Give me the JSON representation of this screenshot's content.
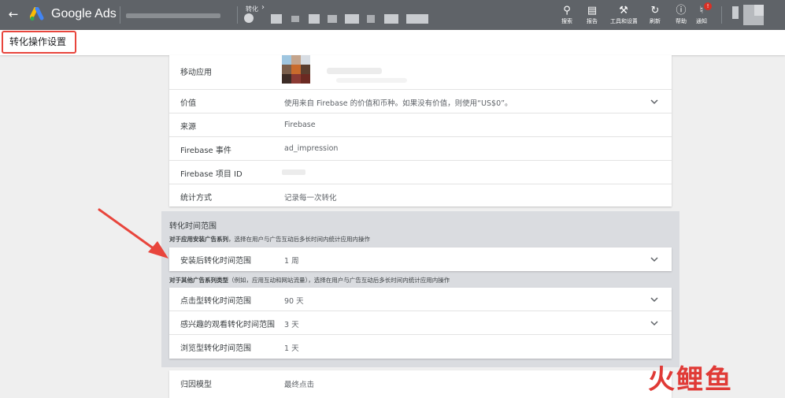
{
  "topbar": {
    "brand": "Google Ads",
    "crumb_small": "转化",
    "tools": [
      {
        "icon": "search-icon",
        "label": "搜索"
      },
      {
        "icon": "chart-icon",
        "label": "报告"
      },
      {
        "icon": "wrench-icon",
        "label": "工具和设置"
      },
      {
        "icon": "refresh-icon",
        "label": "刷新"
      },
      {
        "icon": "help-icon",
        "label": "帮助"
      },
      {
        "icon": "bell-icon",
        "label": "通知"
      }
    ],
    "notif_badge": "!"
  },
  "page": {
    "title": "转化操作设置"
  },
  "details": {
    "app_label": "移动应用",
    "rows": [
      {
        "label": "价值",
        "value": "使用来自 Firebase 的价值和币种。如果没有价值，则使用“US$0”。",
        "dropdown": true
      },
      {
        "label": "来源",
        "value": "Firebase",
        "dropdown": false
      },
      {
        "label": "Firebase 事件",
        "value": "ad_impression",
        "dropdown": false
      },
      {
        "label": "Firebase 项目 ID",
        "value": "",
        "dropdown": false
      },
      {
        "label": "统计方式",
        "value": "记录每一次转化",
        "dropdown": false
      }
    ]
  },
  "window": {
    "title": "转化时间范围",
    "install_note_bold": "对于应用安装广告系列",
    "install_note": "，选择在用户与广告互动后多长时间内统计应用内操作",
    "install_row": {
      "label": "安装后转化时间范围",
      "value": "1 周"
    },
    "other_note_bold": "对于其他广告系列类型",
    "other_note": "（例如，应用互动和网站流量），选择在用户与广告互动后多长时间内统计应用内操作",
    "other_rows": [
      {
        "label": "点击型转化时间范围",
        "value": "90 天",
        "dropdown": true
      },
      {
        "label": "感兴趣的观看转化时间范围",
        "value": "3 天",
        "dropdown": true
      },
      {
        "label": "浏览型转化时间范围",
        "value": "1 天",
        "dropdown": false
      }
    ]
  },
  "attribution": {
    "label": "归因模型",
    "value": "最终点击"
  },
  "watermark": "火鲤鱼",
  "colors": {
    "topbar": "#5f6368",
    "highlight": "#e8453c",
    "section_bg": "#dadce0"
  }
}
